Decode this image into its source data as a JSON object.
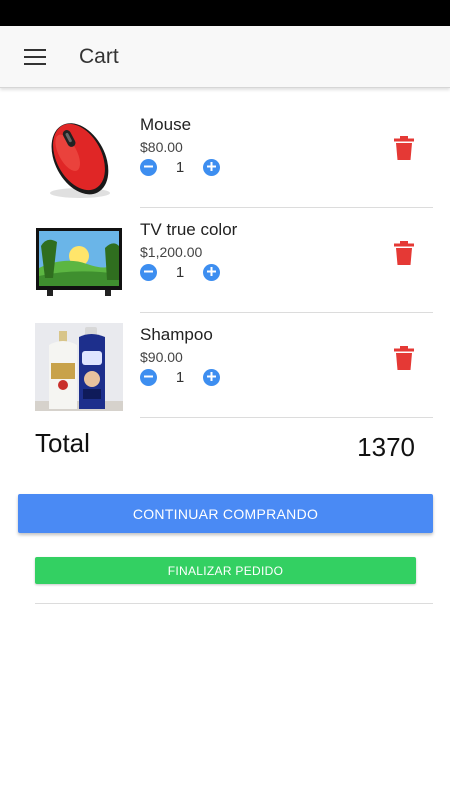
{
  "toolbar": {
    "title": "Cart",
    "menu_icon": "menu-icon"
  },
  "items": [
    {
      "name": "Mouse",
      "price": "$80.00",
      "quantity": "1",
      "image": "red-computer-mouse"
    },
    {
      "name": "TV true color",
      "price": "$1,200.00",
      "quantity": "1",
      "image": "flat-screen-tv-landscape"
    },
    {
      "name": "Shampoo",
      "price": "$90.00",
      "quantity": "1",
      "image": "shampoo-bottles"
    }
  ],
  "summary": {
    "total_label": "Total",
    "total_value": "1370"
  },
  "actions": {
    "continue_label": "CONTINUAR COMPRANDO",
    "finalize_label": "FINALIZAR PEDIDO"
  },
  "colors": {
    "accent_blue": "#4a8af4",
    "finalize_green": "#33d062",
    "delete_red": "#e53935",
    "qty_blue": "#3d8ef0"
  }
}
